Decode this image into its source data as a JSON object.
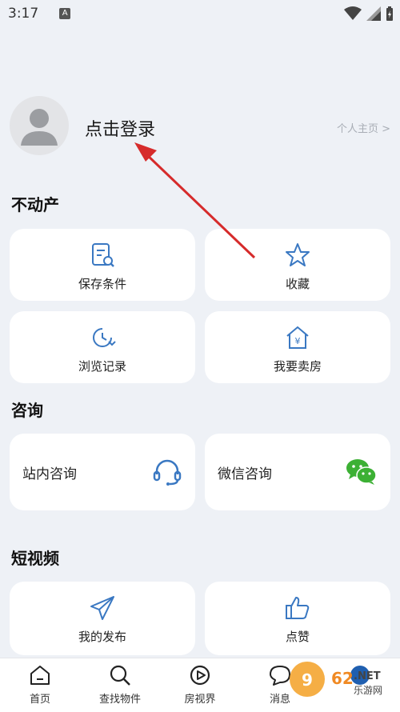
{
  "status": {
    "time": "3:17",
    "app_badge": "A"
  },
  "profile": {
    "login_label": "点击登录",
    "home_link": "个人主页 >"
  },
  "sections": {
    "real_estate": {
      "title": "不动产",
      "items": [
        {
          "label": "保存条件",
          "icon": "saved-search-icon"
        },
        {
          "label": "收藏",
          "icon": "star-icon"
        },
        {
          "label": "浏览记录",
          "icon": "history-clock-icon"
        },
        {
          "label": "我要卖房",
          "icon": "sell-house-icon"
        }
      ]
    },
    "consult": {
      "title": "咨询",
      "items": [
        {
          "label": "站内咨询",
          "icon": "headset-icon"
        },
        {
          "label": "微信咨询",
          "icon": "wechat-icon"
        }
      ]
    },
    "short_video": {
      "title": "短视频",
      "items": [
        {
          "label": "我的发布",
          "icon": "send-plane-icon"
        },
        {
          "label": "点赞",
          "icon": "thumbs-up-icon"
        }
      ]
    }
  },
  "tabbar": [
    {
      "label": "首页",
      "icon": "home-icon"
    },
    {
      "label": "查找物件",
      "icon": "search-icon"
    },
    {
      "label": "房视界",
      "icon": "play-icon"
    },
    {
      "label": "消息",
      "icon": "chat-icon"
    },
    {
      "label": "",
      "icon": "profile-icon"
    }
  ],
  "watermark": {
    "text": "962.NET",
    "subtext": "乐游网"
  },
  "colors": {
    "accent": "#3a78c2",
    "background": "#eef1f6",
    "annotation": "#d62b2b",
    "wechat": "#3cb034"
  }
}
